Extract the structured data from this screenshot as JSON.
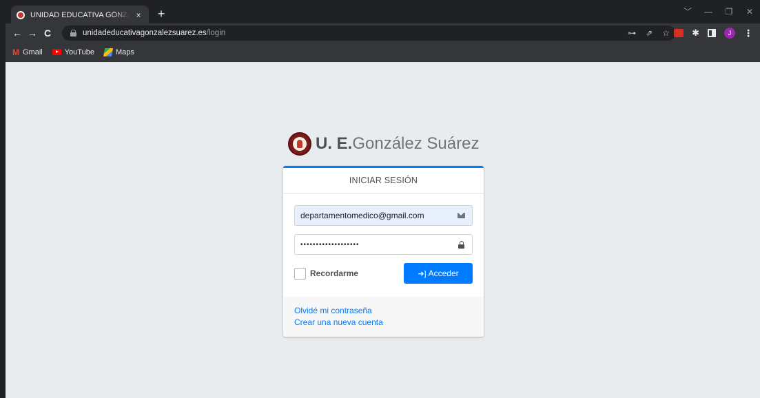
{
  "browser": {
    "tab_title": "UNIDAD EDUCATIVA GÓNZALEZ",
    "tab_close": "×",
    "new_tab": "+",
    "url_host": "unidadeducativagonzalezsuarez.es",
    "url_path": "/login",
    "window_controls": [
      "﹀",
      "—",
      "❐",
      "✕"
    ],
    "nav": {
      "back": "←",
      "forward": "→",
      "reload": "C"
    },
    "omni_icons": [
      "⊶",
      "⇗",
      "☆"
    ],
    "avatar_letter": "J",
    "bookmarks": [
      {
        "label": "Gmail",
        "icon": "gmail-icon"
      },
      {
        "label": "YouTube",
        "icon": "youtube-icon"
      },
      {
        "label": "Maps",
        "icon": "maps-icon"
      }
    ]
  },
  "brand": {
    "bold": "U. E.",
    "light": "González Suárez"
  },
  "login": {
    "header": "INICIAR SESIÓN",
    "email_value": "departamentomedico@gmail.com",
    "password_value": "•••••••••••••••••••",
    "remember_label": "Recordarme",
    "submit_label": "Acceder",
    "forgot_link": "Olvidé mi contraseña",
    "register_link": "Crear una nueva cuenta"
  },
  "colors": {
    "primary": "#007bff",
    "page_bg": "#e9ecef",
    "autofill": "#e8f0fe"
  }
}
